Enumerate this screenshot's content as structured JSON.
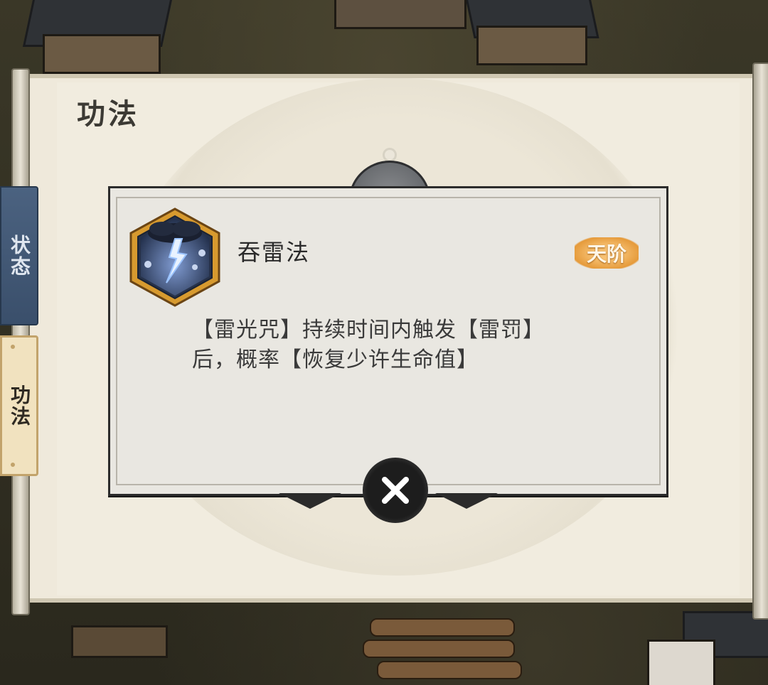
{
  "panel": {
    "title": "功法"
  },
  "tabs": [
    {
      "label": "状态",
      "active": false
    },
    {
      "label": "功法",
      "active": true
    }
  ],
  "dialog": {
    "skill_name": "吞雷法",
    "rank": "天阶",
    "description_line1": "【雷光咒】持续时间内触发【雷罚】",
    "description_line2": "后，概率【恢复少许生命值】",
    "icon": "lightning-cloud-icon",
    "close_icon": "close-icon"
  },
  "colors": {
    "tab_status": "#3a4f6b",
    "tab_active": "#f1e2bf",
    "rank_badge": "#e59a3a",
    "dialog_bg": "#e9e7e1"
  }
}
